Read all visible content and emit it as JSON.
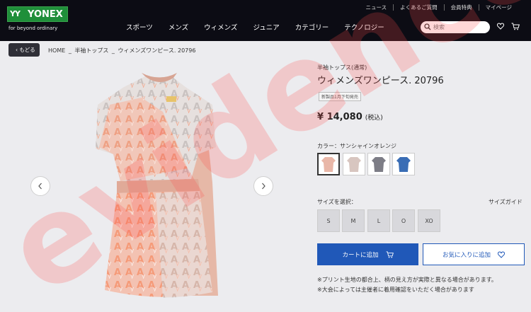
{
  "brand": {
    "name": "YONEX",
    "tagline": "for beyond ordinary"
  },
  "utility_links": [
    "ニュース",
    "よくあるご質問",
    "会員特典",
    "マイページ"
  ],
  "main_nav": [
    "スポーツ",
    "メンズ",
    "ウィメンズ",
    "ジュニア",
    "カテゴリー",
    "テクノロジー"
  ],
  "search": {
    "placeholder": "検索"
  },
  "back_label": "もどる",
  "breadcrumb": [
    "HOME",
    "_",
    "半袖トップス",
    "_",
    "ウィメンズワンピース. 20796"
  ],
  "product": {
    "category": "半袖トップス(通常)",
    "name": "ウィメンズワンピース. 20796",
    "badge": "新製品1月下旬発売",
    "price": "¥ 14,080",
    "tax": "(税込)",
    "color_label": "カラー：サンシャインオレンジ",
    "swatch_colors": [
      "#e9b7a8",
      "#d8c6c0",
      "#7d7d86",
      "#3a6db5"
    ],
    "size_label": "サイズを選択：",
    "size_guide": "サイズガイド",
    "sizes": [
      "S",
      "M",
      "L",
      "O",
      "XO"
    ],
    "cart_button": "カートに追加",
    "favorite_button": "お気に入りに追加",
    "notes": [
      "※プリント生地の都合上、柄の見え方が実際と異なる場合があります。",
      "※大会によっては主催者に着用確認をいただく場合があります"
    ]
  },
  "watermark": "evidence",
  "colors": {
    "header": "#0c0c14",
    "accent": "#2058b8",
    "logo_green": "#1f8f3a",
    "dress": "#f0a68a"
  }
}
